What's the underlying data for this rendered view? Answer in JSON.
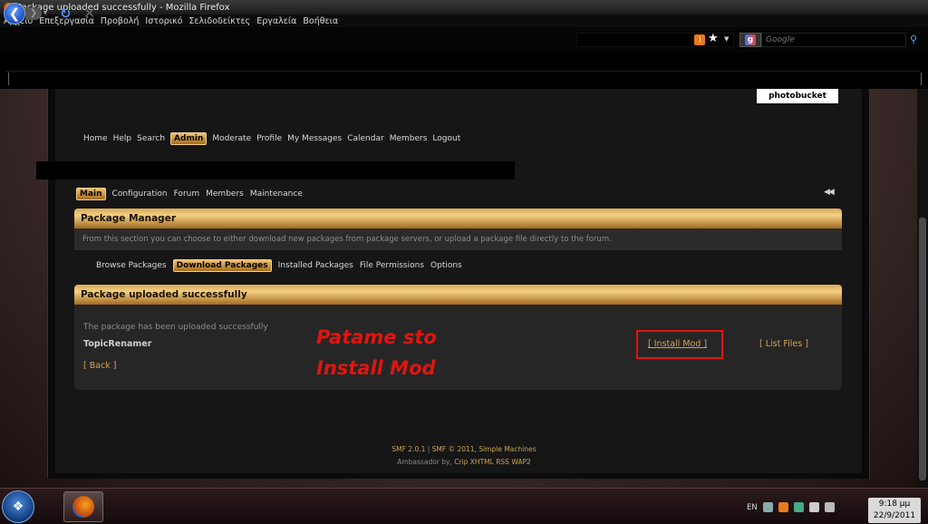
{
  "window": {
    "title": "Package uploaded successfully - Mozilla Firefox"
  },
  "menu": [
    "Αρχείο",
    "Επεξεργασία",
    "Προβολή",
    "Ιστορικό",
    "Σελιδοδείκτες",
    "Εργαλεία",
    "Βοήθεια"
  ],
  "search": {
    "placeholder": "Google"
  },
  "logo": {
    "text": "photobucket"
  },
  "forum_nav": [
    "Home",
    "Help",
    "Search",
    "Admin",
    "Moderate",
    "Profile",
    "My Messages",
    "Calendar",
    "Members",
    "Logout"
  ],
  "admin_nav": [
    "Main",
    "Configuration",
    "Forum",
    "Members",
    "Maintenance"
  ],
  "package_manager": {
    "title": "Package Manager",
    "description": "From this section you can choose to either download new packages from package servers, or upload a package file directly to the forum.",
    "tabs": [
      "Browse Packages",
      "Download Packages",
      "Installed Packages",
      "File Permissions",
      "Options"
    ]
  },
  "upload": {
    "title": "Package uploaded successfully",
    "message": "The package has been uploaded successfully",
    "package_name": "TopicRenamer",
    "back": "[ Back ]",
    "install": "[ Install Mod ]",
    "list": "[ List Files ]"
  },
  "annotation": {
    "line1": "Patame sto",
    "line2": "Install Mod"
  },
  "footer": {
    "smf": "SMF 2.0.1",
    "sep": " | ",
    "copyright": "SMF © 2011, Simple Machines",
    "ambassador": "Ambassador by,",
    "links": [
      "Crip",
      "XHTML",
      "RSS",
      "WAP2"
    ]
  },
  "tray": {
    "lang": "EN",
    "time": "9:18 μμ",
    "date": "22/9/2011"
  },
  "colors": {
    "accent_gold": "#d4a24f",
    "annotation_red": "#e0150f"
  }
}
